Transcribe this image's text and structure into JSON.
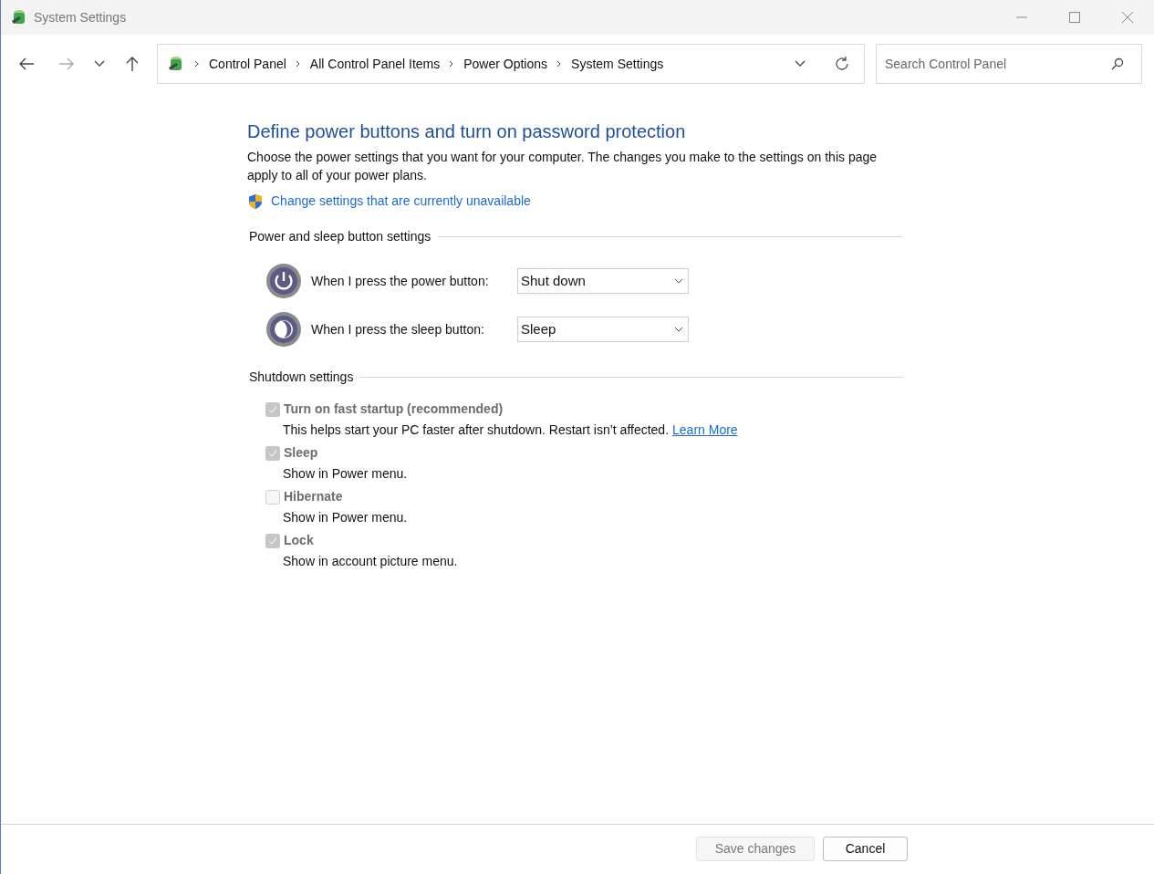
{
  "window": {
    "title": "System Settings"
  },
  "address_bar": {
    "breadcrumbs": [
      "Control Panel",
      "All Control Panel Items",
      "Power Options",
      "System Settings"
    ]
  },
  "search": {
    "placeholder": "Search Control Panel"
  },
  "heading": "Define power buttons and turn on password protection",
  "description": "Choose the power settings that you want for your computer. The changes you make to the settings on this page apply to all of your power plans.",
  "admin_link": "Change settings that are currently unavailable",
  "button_settings": {
    "title": "Power and sleep button settings",
    "rows": [
      {
        "kind": "power",
        "label": "When I press the power button:",
        "value": "Shut down"
      },
      {
        "kind": "sleep",
        "label": "When I press the sleep button:",
        "value": "Sleep"
      }
    ]
  },
  "shutdown_settings": {
    "title": "Shutdown settings",
    "options": [
      {
        "label": "Turn on fast startup (recommended)",
        "checked": true,
        "disabled": true,
        "description": "This helps start your PC faster after shutdown. Restart isn’t affected.",
        "link": "Learn More"
      },
      {
        "label": "Sleep",
        "checked": true,
        "disabled": true,
        "description": "Show in Power menu."
      },
      {
        "label": "Hibernate",
        "checked": false,
        "disabled": true,
        "description": "Show in Power menu."
      },
      {
        "label": "Lock",
        "checked": true,
        "disabled": true,
        "description": "Show in account picture menu."
      }
    ]
  },
  "footer": {
    "buttons": [
      {
        "label": "Save changes",
        "disabled": true
      },
      {
        "label": "Cancel",
        "disabled": false
      }
    ]
  }
}
